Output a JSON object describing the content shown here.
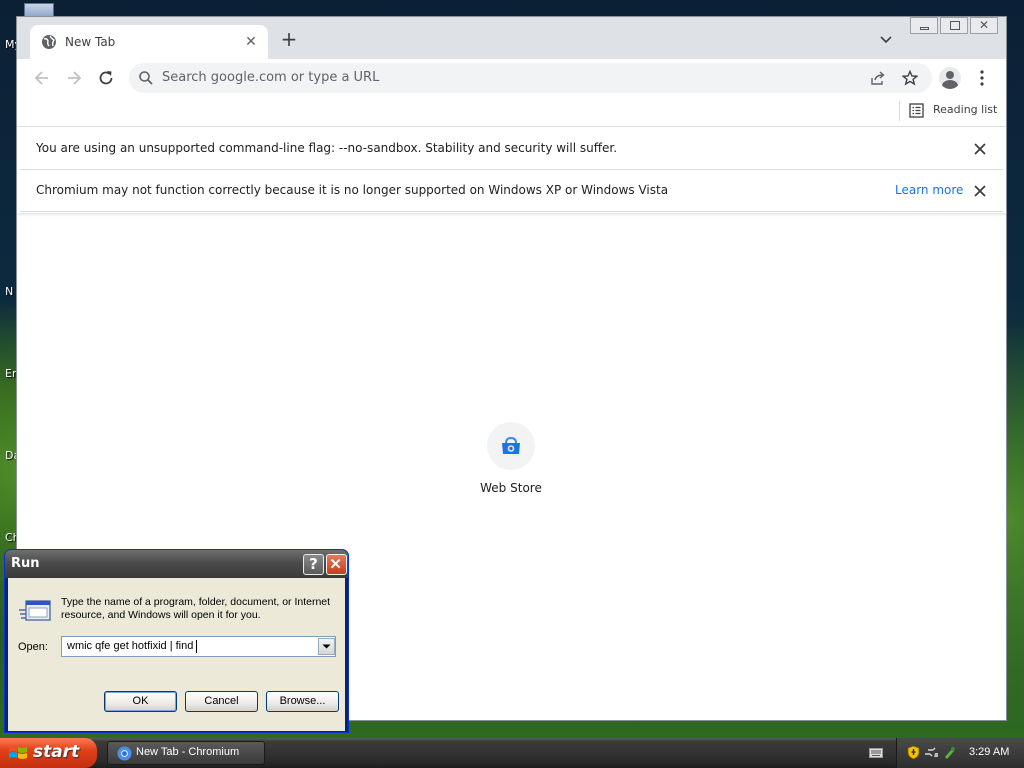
{
  "desktop": {
    "labels": [
      "My",
      "N",
      "En",
      "Da",
      "Ch"
    ]
  },
  "browser": {
    "tab": {
      "title": "New Tab"
    },
    "omnibox": {
      "placeholder": "Search google.com or type a URL"
    },
    "bookmarks": {
      "reading_list": "Reading list"
    },
    "infobars": [
      {
        "text": "You are using an unsupported command-line flag: --no-sandbox. Stability and security will suffer."
      },
      {
        "text": "Chromium may not function correctly because it is no longer supported on Windows XP or Windows Vista",
        "link": "Learn more"
      }
    ],
    "shortcut": {
      "label": "Web Store"
    }
  },
  "run_dialog": {
    "title": "Run",
    "help": "?",
    "description": "Type the name of a program, folder, document, or Internet resource, and Windows will open it for you.",
    "open_label": "Open:",
    "input_value": "wmic qfe get hotfixid | find ",
    "buttons": {
      "ok": "OK",
      "cancel": "Cancel",
      "browse": "Browse..."
    }
  },
  "taskbar": {
    "start": "start",
    "task": "New Tab - Chromium",
    "clock": "3:29 AM"
  },
  "colors": {
    "accent_link": "#1a73e8",
    "start_button": "#e0411a"
  }
}
